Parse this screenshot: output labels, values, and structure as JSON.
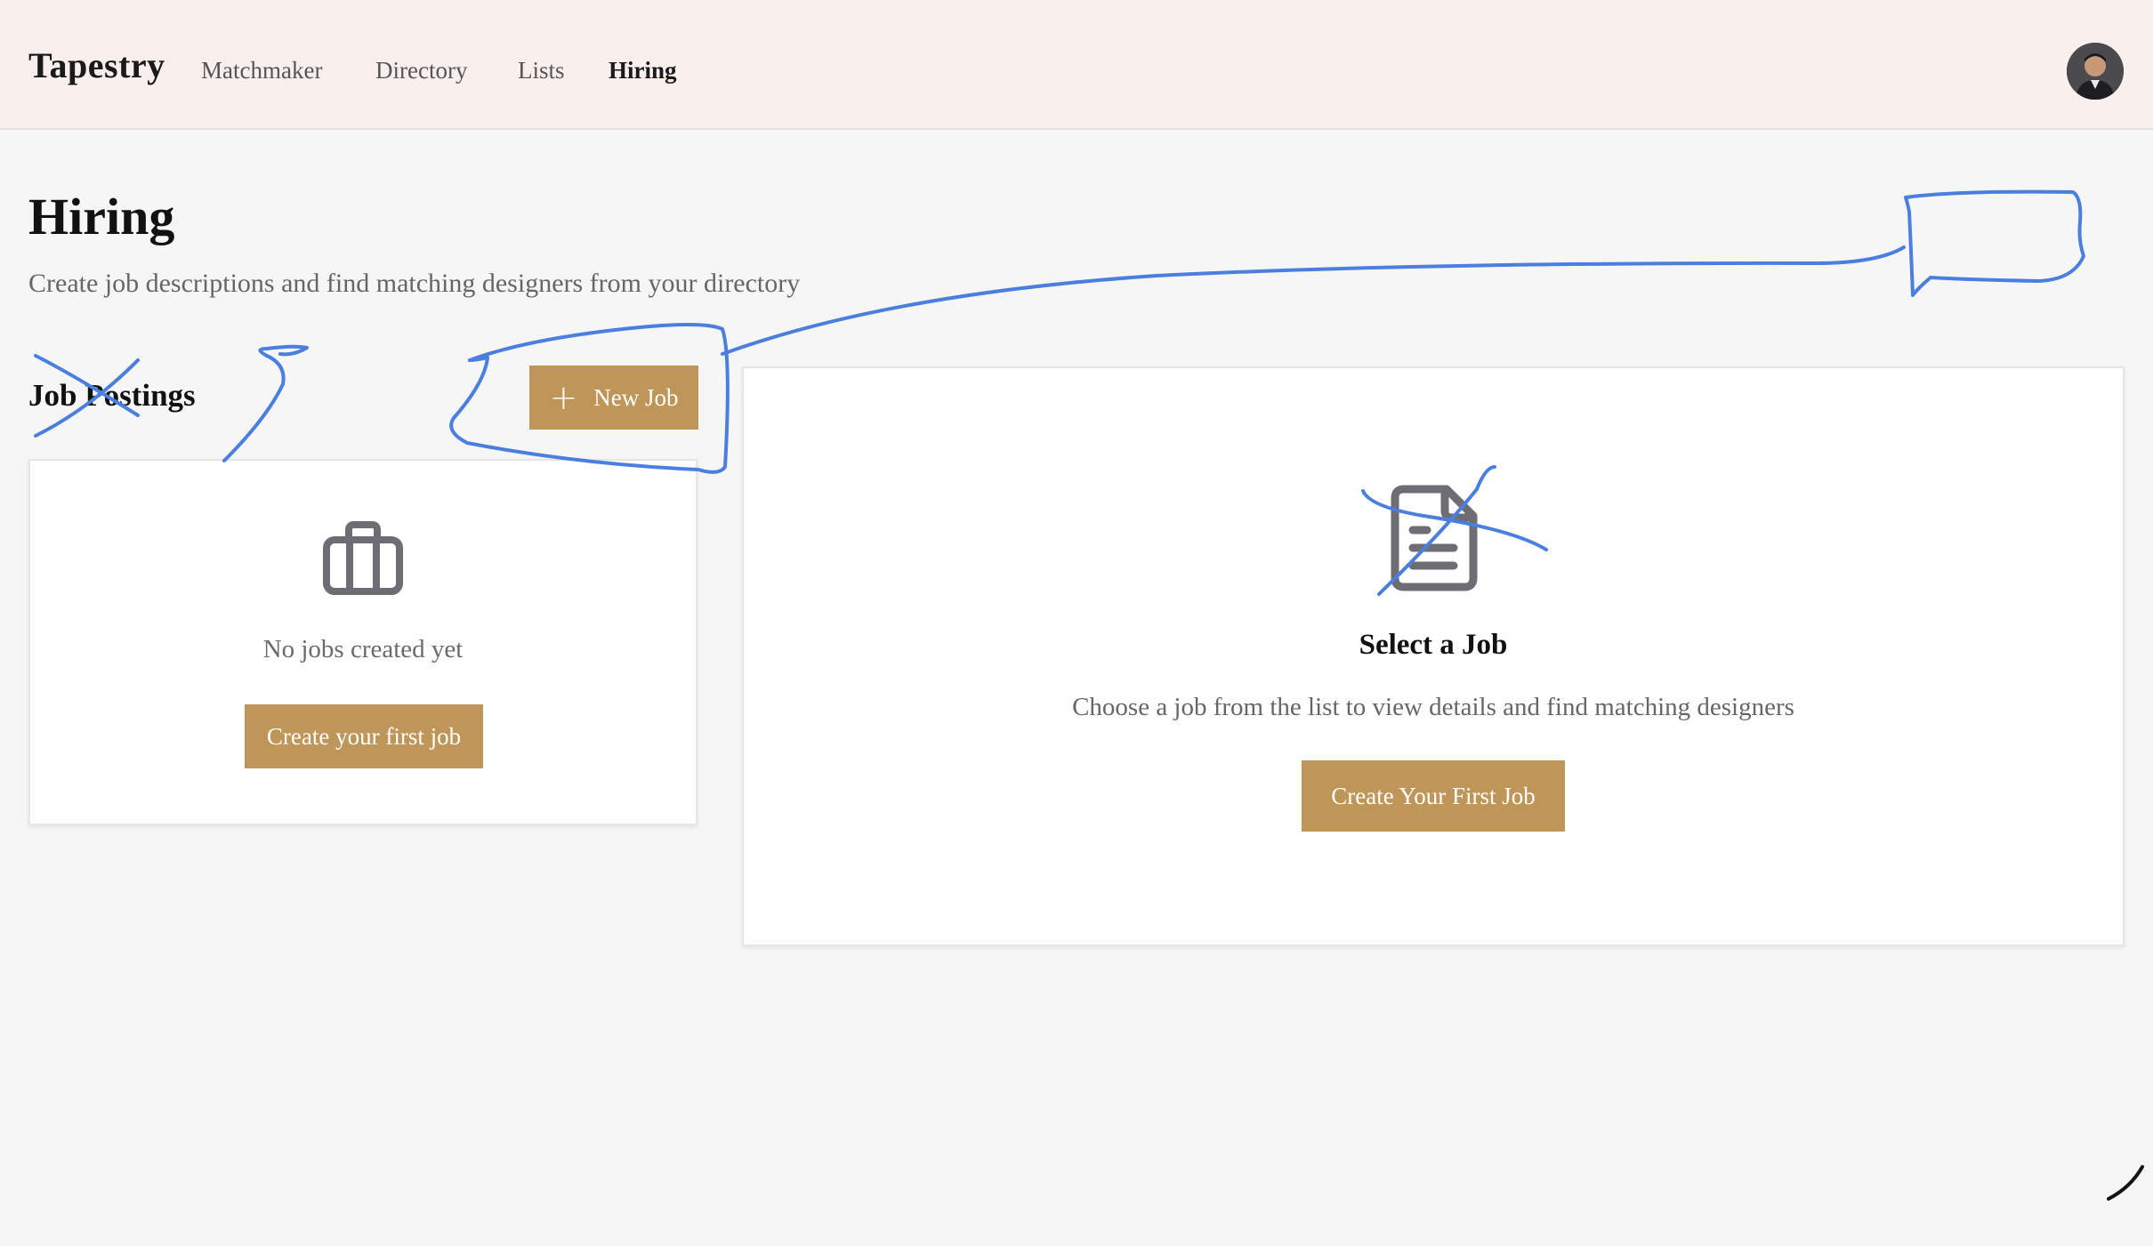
{
  "header": {
    "brand": "Tapestry",
    "nav": [
      {
        "label": "Matchmaker",
        "active": false
      },
      {
        "label": "Directory",
        "active": false
      },
      {
        "label": "Lists",
        "active": false
      },
      {
        "label": "Hiring",
        "active": true
      }
    ],
    "avatar_icon": "user-avatar"
  },
  "page": {
    "title": "Hiring",
    "subtitle": "Create job descriptions and find matching designers from your directory"
  },
  "job_postings": {
    "title": "Job Postings",
    "new_job_label": "New Job",
    "new_job_icon": "plus-icon",
    "empty_icon": "briefcase-icon",
    "empty_text": "No jobs created yet",
    "create_button_label": "Create your first job"
  },
  "detail": {
    "icon": "document-icon",
    "title": "Select a Job",
    "description": "Choose a job from the list to view details and find matching designers",
    "create_button_label": "Create Your First Job"
  },
  "colors": {
    "accent": "#bf9659",
    "header_bg": "#f9efec",
    "page_bg": "#f6f6f6",
    "annotation_stroke": "#4a7fe0",
    "icon_gray": "#6e6d73"
  }
}
